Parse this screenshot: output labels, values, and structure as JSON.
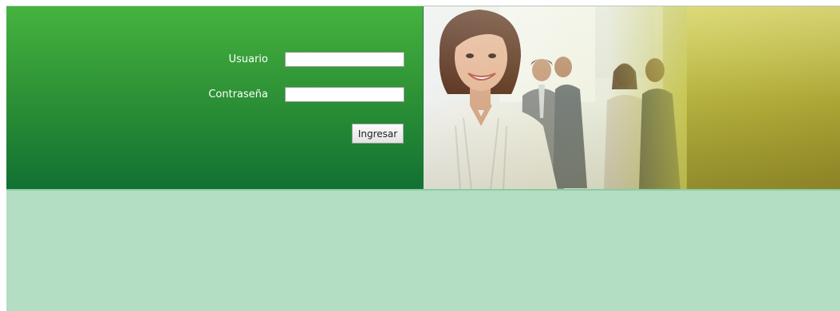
{
  "login": {
    "username_label": "Usuario",
    "password_label": "Contraseña",
    "username_value": "",
    "password_value": "",
    "submit_label": "Ingresar"
  },
  "colors": {
    "panel_green_top": "#45b33f",
    "panel_green_bottom": "#117133",
    "footer_mint": "#b3dec3",
    "accent_olive": "#c7c640"
  },
  "hero_image": {
    "subject": "smiling-businesswoman-with-colleagues-photo"
  }
}
